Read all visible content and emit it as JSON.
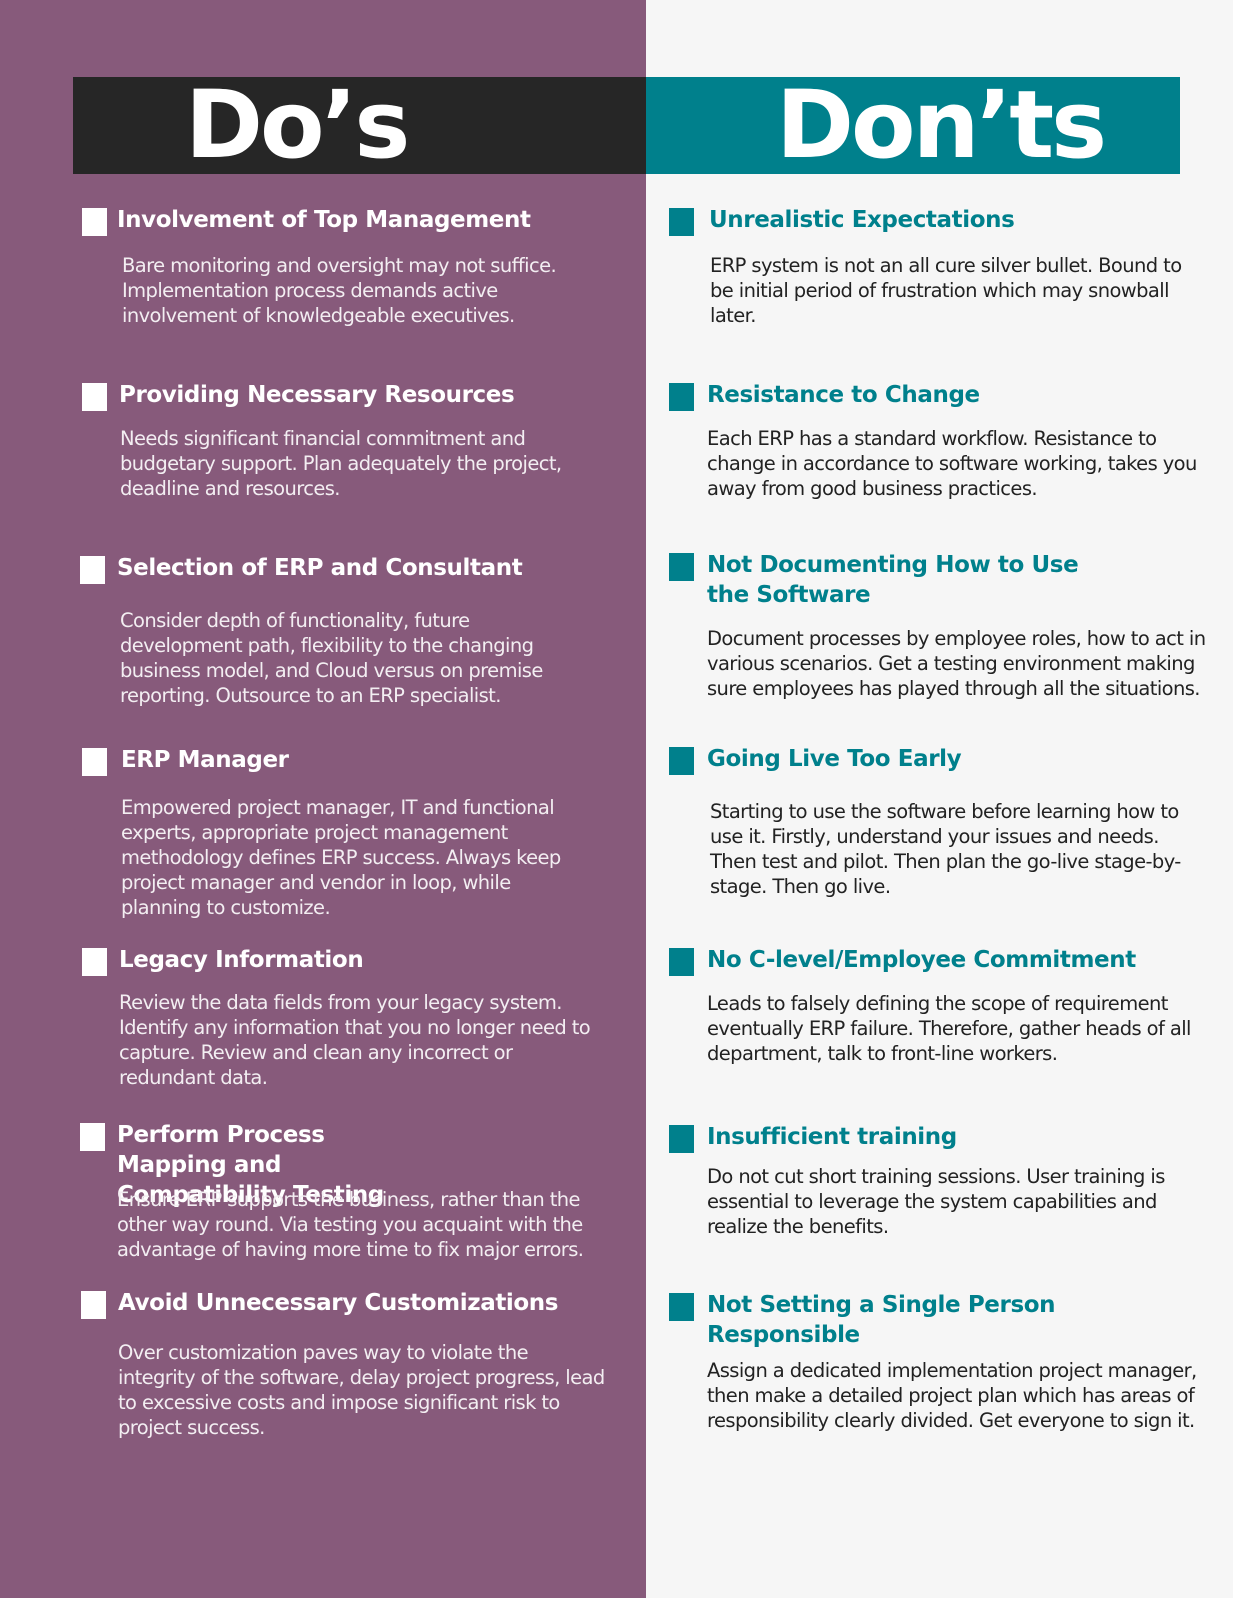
{
  "colors": {
    "dos_background": "#875a7b",
    "donts_background": "#f6f6f6",
    "dos_banner": "#262626",
    "donts_banner": "#00808c",
    "accent_teal": "#00808c"
  },
  "dos": {
    "title": "Do’s",
    "items": [
      {
        "title": "Involvement of Top Management",
        "body": "Bare monitoring and oversight may not suffice. Implementation process demands active involvement of knowledgeable executives."
      },
      {
        "title": "Providing Necessary Resources",
        "body": "Needs significant financial commitment and budgetary support. Plan adequately the project, deadline and resources."
      },
      {
        "title": "Selection of ERP and Consultant",
        "body": "Consider depth of functionality, future development path, flexibility to the changing business model, and Cloud versus on premise reporting. Outsource to an ERP specialist."
      },
      {
        "title": "ERP Manager",
        "body": "Empowered project manager, IT and functional experts, appropriate project management methodology defines ERP success. Always keep project manager and vendor in loop, while planning to customize."
      },
      {
        "title": "Legacy Information",
        "body": "Review the data fields from your legacy system. Identify any information that you no longer need to capture. Review and clean any incorrect or redundant data."
      },
      {
        "title": "Perform Process Mapping and Compatibility Testing",
        "body": "Ensure ERP supports the business, rather than the other way round. Via testing you acquaint with the advantage of having more time to fix major errors."
      },
      {
        "title": "Avoid Unnecessary Customizations",
        "body": "Over customization paves way to violate the integrity of the software, delay project progress, lead to excessive costs and impose significant risk to project success."
      }
    ]
  },
  "donts": {
    "title": "Don’ts",
    "items": [
      {
        "title": "Unrealistic Expectations",
        "body": "ERP system is not an all cure silver bullet. Bound to be initial period of frustration which may snowball later."
      },
      {
        "title": "Resistance to Change",
        "body": "Each ERP has a standard workflow. Resistance to change in accordance to software working, takes you away from good business practices."
      },
      {
        "title": "Not Documenting How to Use the Software",
        "body": "Document processes by employee roles, how to act in various scenarios. Get a testing environment making sure employees has played through all the situations."
      },
      {
        "title": "Going Live Too Early",
        "body": "Starting to use the software before learning how to use it. Firstly, understand your issues and needs. Then test and pilot. Then plan the go-live stage-by-stage. Then go live."
      },
      {
        "title": "No C-level/Employee Commitment",
        "body": "Leads to falsely defining the scope of requirement eventually ERP failure. Therefore, gather heads of all department, talk to front-line workers."
      },
      {
        "title": "Insufficient training",
        "body": "Do not cut short training sessions. User training is essential to leverage the system capabilities and realize the benefits."
      },
      {
        "title": "Not Setting a Single Person Responsible",
        "body": "Assign a dedicated implementation project manager, then make a detailed project plan which has areas of responsibility clearly divided. Get everyone to sign it."
      }
    ]
  }
}
